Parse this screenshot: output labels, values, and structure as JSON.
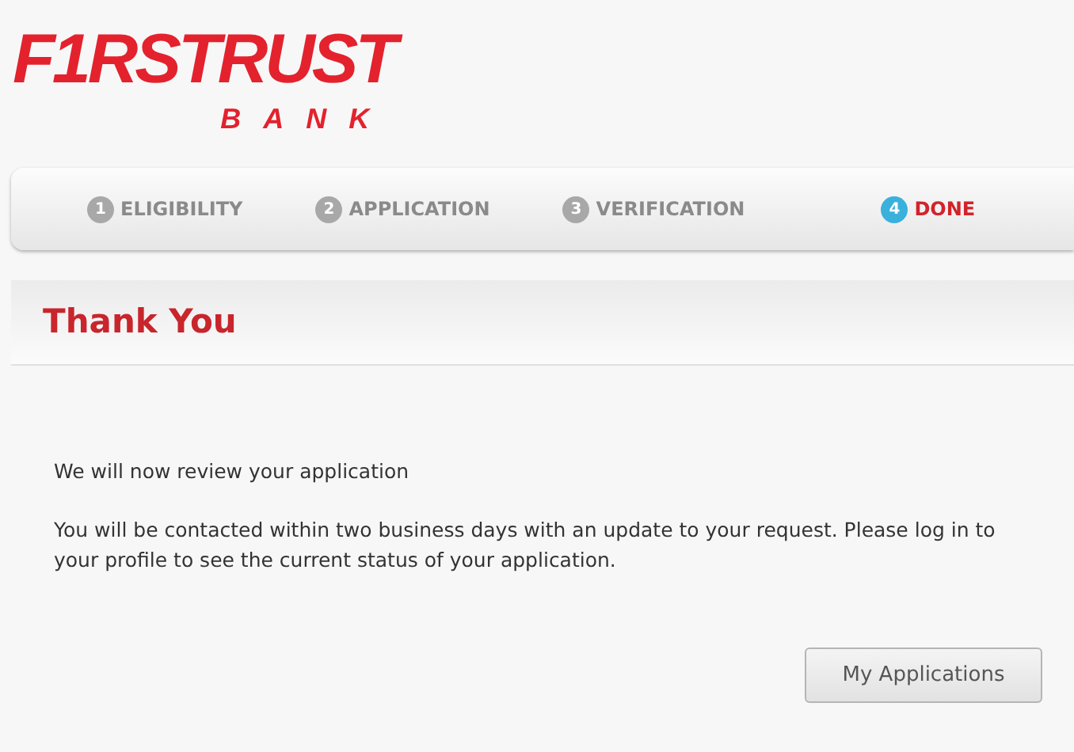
{
  "logo": {
    "name": "F1RSTRUST",
    "subtitle": "BANK"
  },
  "steps": [
    {
      "number": "1",
      "label": "ELIGIBILITY",
      "selected": false
    },
    {
      "number": "2",
      "label": "APPLICATION",
      "selected": false
    },
    {
      "number": "3",
      "label": "VERIFICATION",
      "selected": false
    },
    {
      "number": "4",
      "label": "DONE",
      "selected": true
    }
  ],
  "panel": {
    "title": "Thank You"
  },
  "paragraphs": [
    "We will now review your application",
    "You will be contacted within two business days with an update to your request. Please log in to your profile to see the current status of your application."
  ],
  "button": "My Applications"
}
